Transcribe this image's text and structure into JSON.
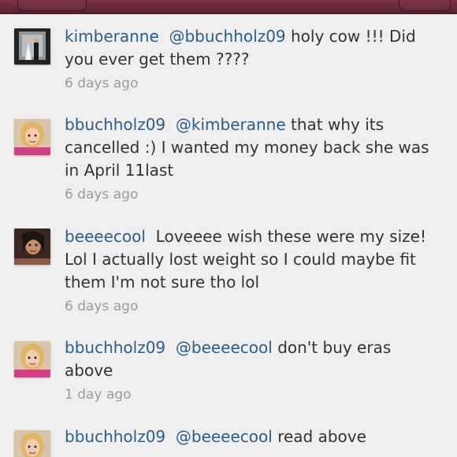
{
  "comments": [
    {
      "username": "kimberanne",
      "mention": "@bbuchholz09",
      "text": "holy cow !!! Did you ever get them ????",
      "time": "6 days ago",
      "avatar_icon": "wedding-photo"
    },
    {
      "username": "bbuchholz09",
      "mention": "@kimberanne",
      "text": "that why its cancelled :) I wanted my money back she was in April 11last",
      "time": "6 days ago",
      "avatar_icon": "blonde-selfie"
    },
    {
      "username": "beeeecool",
      "mention": "",
      "text": "Loveeee wish these were my size! Lol I actually lost weight so I could maybe fit them I'm not sure tho lol",
      "time": "6 days ago",
      "avatar_icon": "brunette-selfie"
    },
    {
      "username": "bbuchholz09",
      "mention": "@beeeecool",
      "text": "don't buy eras above",
      "time": "1 day ago",
      "avatar_icon": "blonde-selfie"
    },
    {
      "username": "bbuchholz09",
      "mention": "@beeeecool",
      "text": "read above",
      "time": "",
      "avatar_icon": "blonde-selfie"
    }
  ],
  "colors": {
    "header_bar": "#6b2a3c",
    "username": "#275f8c",
    "text": "#333333",
    "timestamp": "#9a9a9a",
    "background": "#efefef"
  }
}
